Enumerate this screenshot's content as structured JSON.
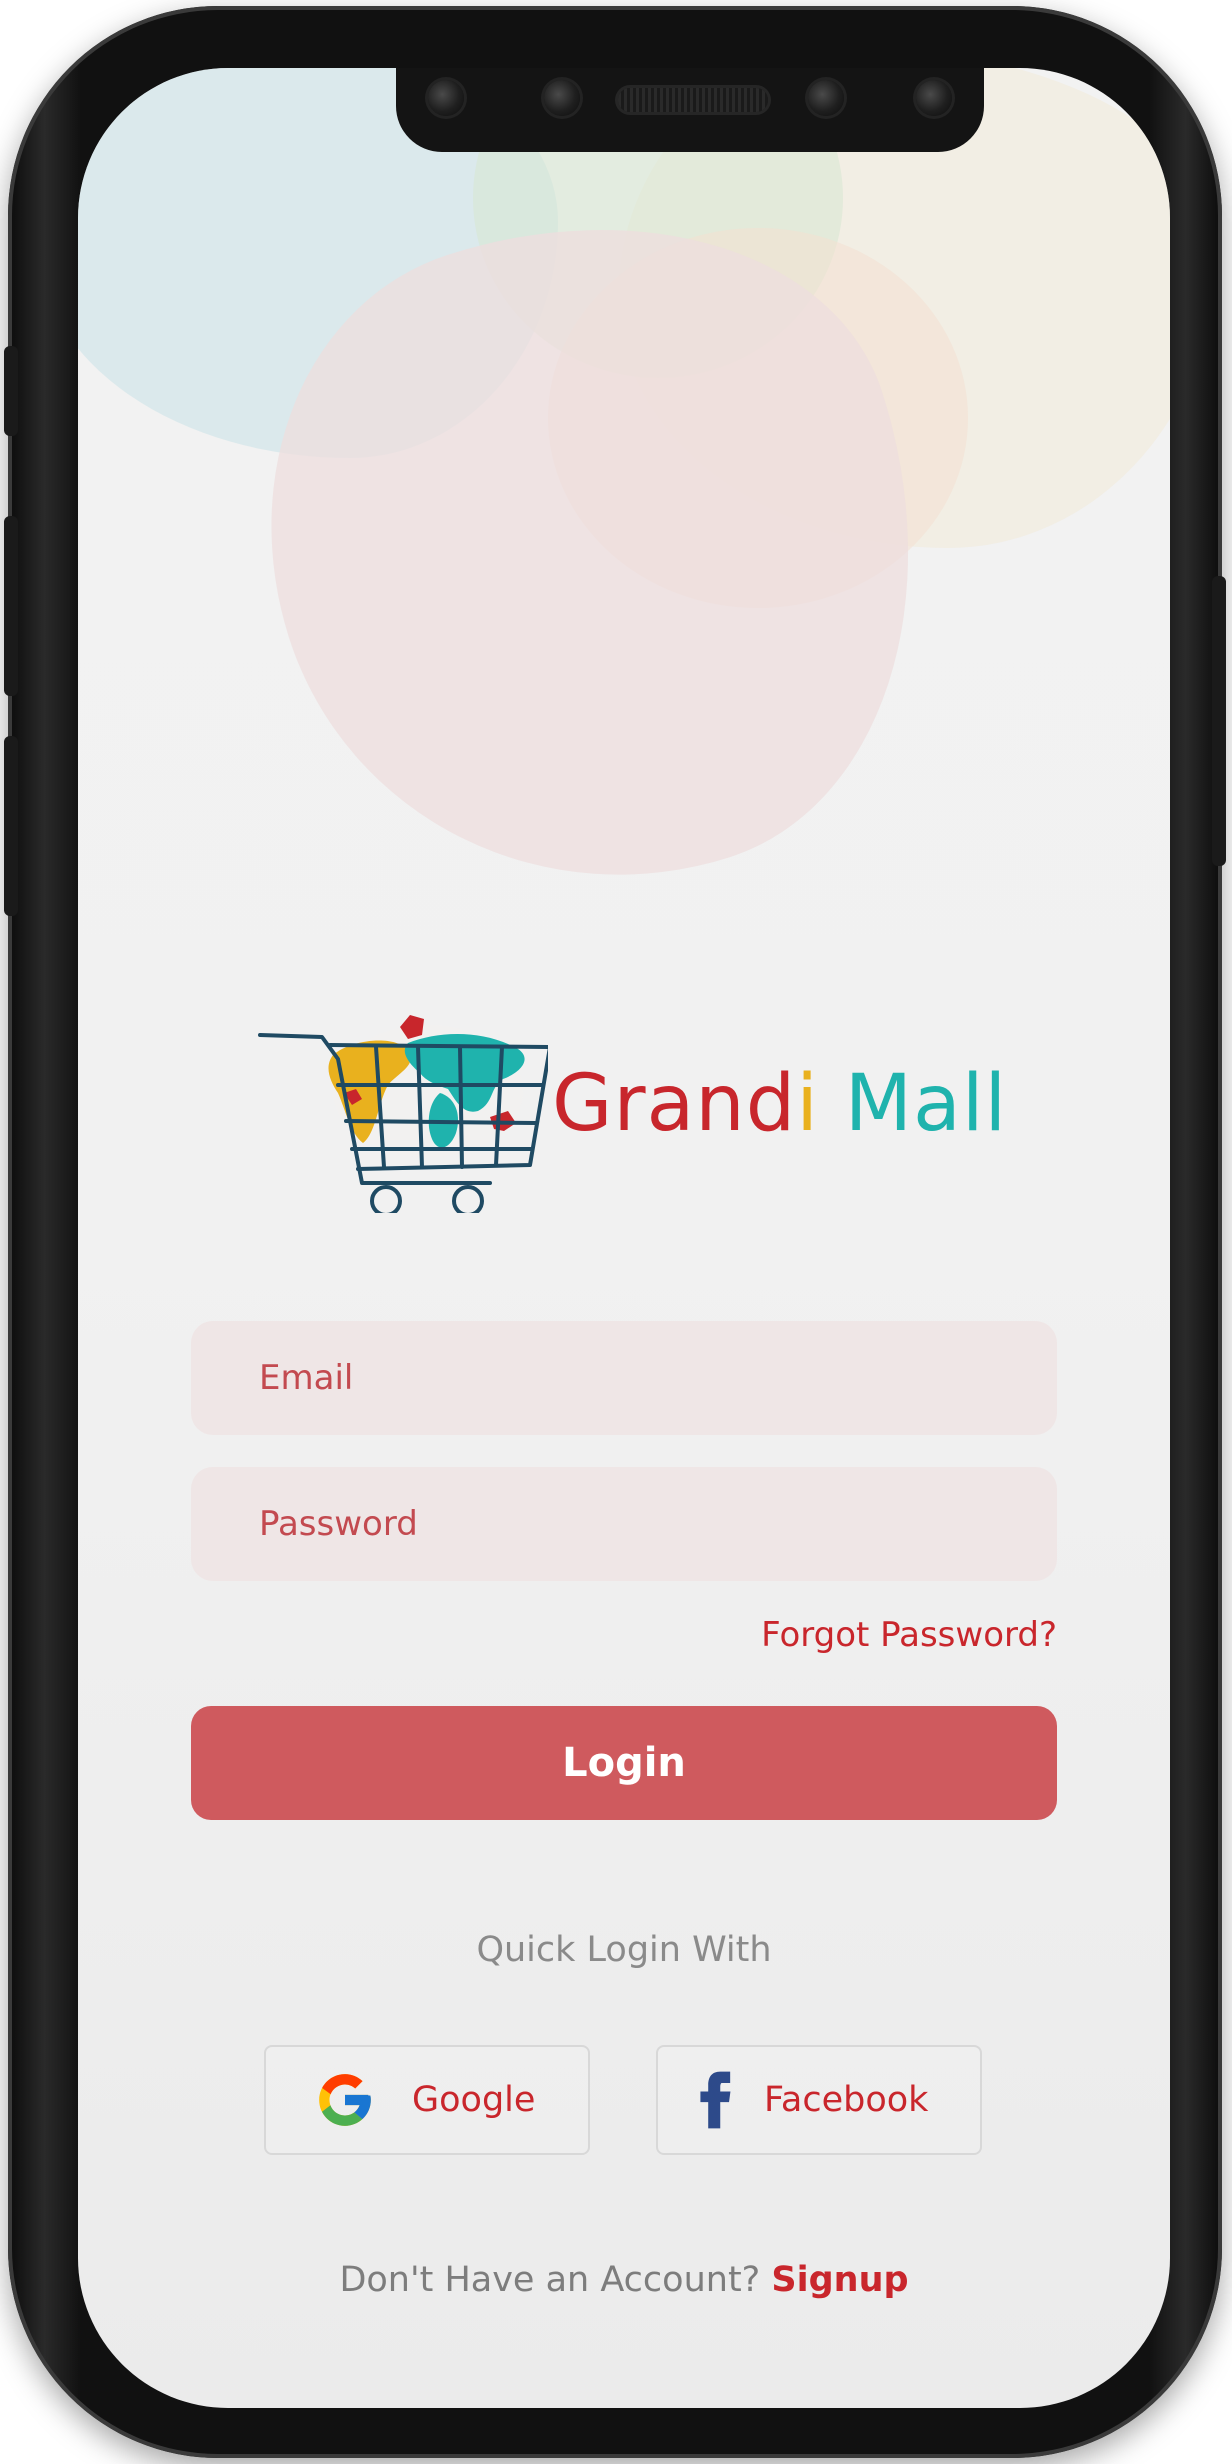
{
  "brand": {
    "part1": "Grand",
    "part2": "i",
    "part3": " Mall",
    "colors": {
      "red": "#c8262c",
      "yellow": "#e9b11e",
      "teal": "#1fb3ad"
    }
  },
  "form": {
    "email_placeholder": "Email",
    "password_placeholder": "Password",
    "forgot_label": "Forgot Password?",
    "login_label": "Login"
  },
  "quick_login": {
    "label": "Quick Login With",
    "google_label": "Google",
    "facebook_label": "Facebook",
    "google_icon": "google-icon",
    "facebook_icon": "facebook-icon"
  },
  "signup": {
    "prompt": "Don't Have an Account?",
    "link_label": "Signup"
  },
  "theme": {
    "accent": "#c9262c",
    "button": "#cf5a5e",
    "field_bg": "#efe6e6"
  }
}
